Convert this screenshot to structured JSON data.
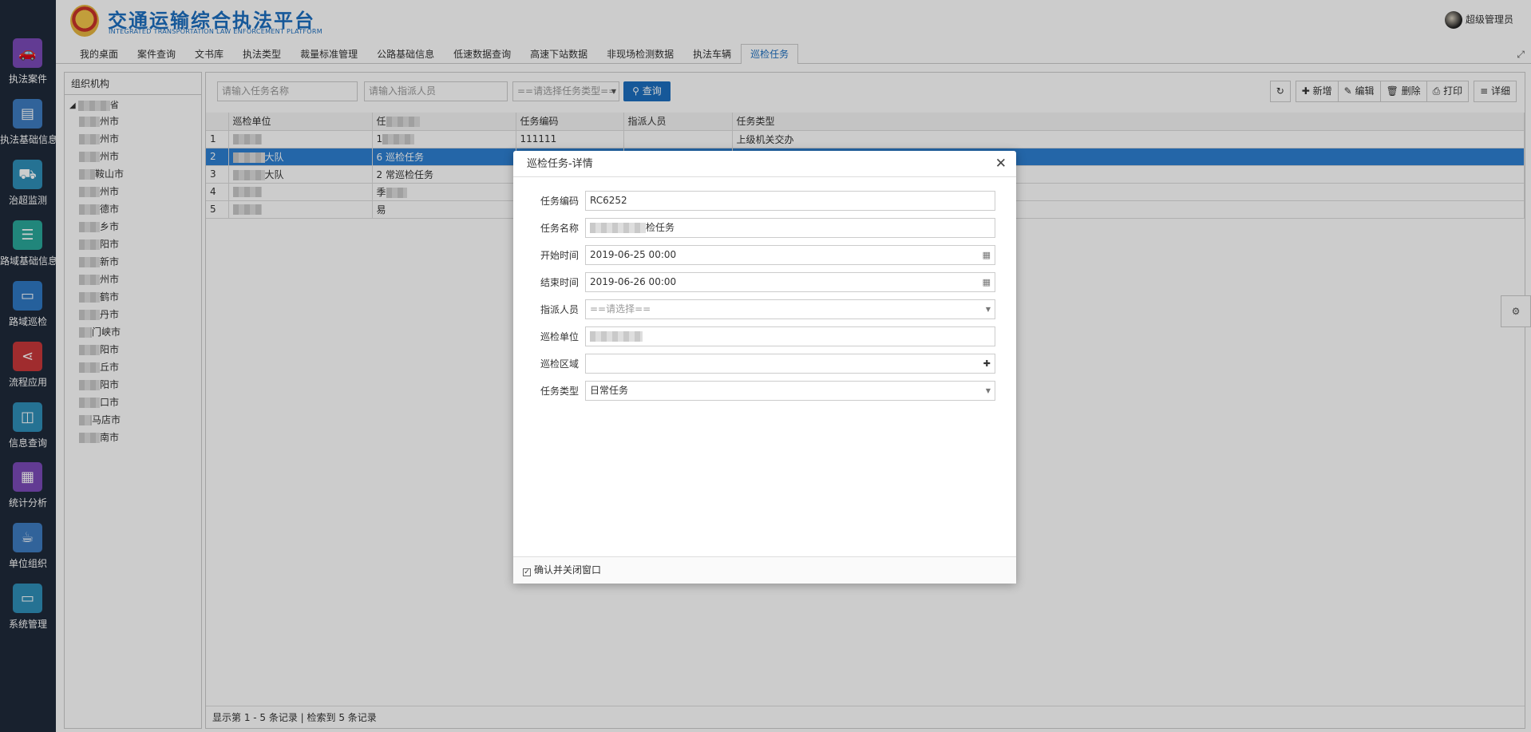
{
  "sidebar": {
    "items": [
      {
        "label": "执法案件",
        "icon": "car-icon",
        "color": "#7b4ab8"
      },
      {
        "label": "执法基础信息",
        "icon": "id-card-icon",
        "color": "#3e7cc1"
      },
      {
        "label": "治超监测",
        "icon": "truck-icon",
        "color": "#2f8fb8"
      },
      {
        "label": "路域基础信息",
        "icon": "list-icon",
        "color": "#2aa89a"
      },
      {
        "label": "路域巡检",
        "icon": "monitor-icon",
        "color": "#2f78c4"
      },
      {
        "label": "流程应用",
        "icon": "share-icon",
        "color": "#c8383a"
      },
      {
        "label": "信息查询",
        "icon": "bath-icon",
        "color": "#2f8fb8"
      },
      {
        "label": "统计分析",
        "icon": "chip-icon",
        "color": "#7b4ab8"
      },
      {
        "label": "单位组织",
        "icon": "coffee-icon",
        "color": "#3e7cc1"
      },
      {
        "label": "系统管理",
        "icon": "desktop-icon",
        "color": "#2f8fb8"
      }
    ]
  },
  "header": {
    "brand": "交通运输综合执法平台",
    "brand_sub": "INTEGRATED TRANSPORTATION LAW ENFORCEMENT PLATFORM",
    "user": "超级管理员",
    "tabs": [
      "我的桌面",
      "案件查询",
      "文书库",
      "执法类型",
      "裁量标准管理",
      "公路基础信息",
      "低速数据查询",
      "高速下站数据",
      "非现场检测数据",
      "执法车辆",
      "巡检任务"
    ],
    "active_tab": "巡检任务"
  },
  "org": {
    "title": "组织机构",
    "items": [
      "州市",
      "州市",
      "州市",
      "鞍山市",
      "州市",
      "德市",
      "乡市",
      "阳市",
      "新市",
      "州市",
      "鹤市",
      "丹市",
      "门峡市",
      "阳市",
      "丘市",
      "阳市",
      "口市",
      "马店市",
      "南市"
    ]
  },
  "search": {
    "task_name_placeholder": "请输入任务名称",
    "assignee_placeholder": "请输入指派人员",
    "task_type_placeholder": "==请选择任务类型==",
    "query_label": "查询"
  },
  "toolbar": {
    "add": "新增",
    "edit": "编辑",
    "delete": "删除",
    "print": "打印",
    "detail": "详细"
  },
  "table": {
    "headers": [
      "",
      "巡检单位",
      "任",
      "任务编码",
      "指派人员",
      "任务类型"
    ],
    "rows": [
      {
        "idx": "1",
        "unit": "",
        "name": "1",
        "code": "111111",
        "assignee": "",
        "type": "上级机关交办"
      },
      {
        "idx": "2",
        "unit": "大队",
        "name": "6 巡检任务",
        "code": "",
        "assignee": "",
        "type": ""
      },
      {
        "idx": "3",
        "unit": "大队",
        "name": "2 常巡检任务",
        "code": "",
        "assignee": "",
        "type": ""
      },
      {
        "idx": "4",
        "unit": "",
        "name": "季",
        "code": "",
        "assignee": "",
        "type": ""
      },
      {
        "idx": "5",
        "unit": "",
        "name": "易",
        "code": "",
        "assignee": "",
        "type": ""
      }
    ]
  },
  "status_bar": "显示第 1 - 5 条记录 | 检索到 5 条记录",
  "modal": {
    "title": "巡检任务-详情",
    "fields": [
      {
        "label": "任务编码",
        "value": "RC6252"
      },
      {
        "label": "任务名称",
        "value": "检任务"
      },
      {
        "label": "开始时间",
        "value": "2019-06-25 00:00"
      },
      {
        "label": "结束时间",
        "value": "2019-06-26 00:00"
      },
      {
        "label": "指派人员",
        "value": "==请选择=="
      },
      {
        "label": "巡检单位",
        "value": ""
      },
      {
        "label": "巡检区域",
        "value": ""
      },
      {
        "label": "任务类型",
        "value": "日常任务"
      }
    ],
    "footer_checkbox": "确认并关闭窗口"
  }
}
